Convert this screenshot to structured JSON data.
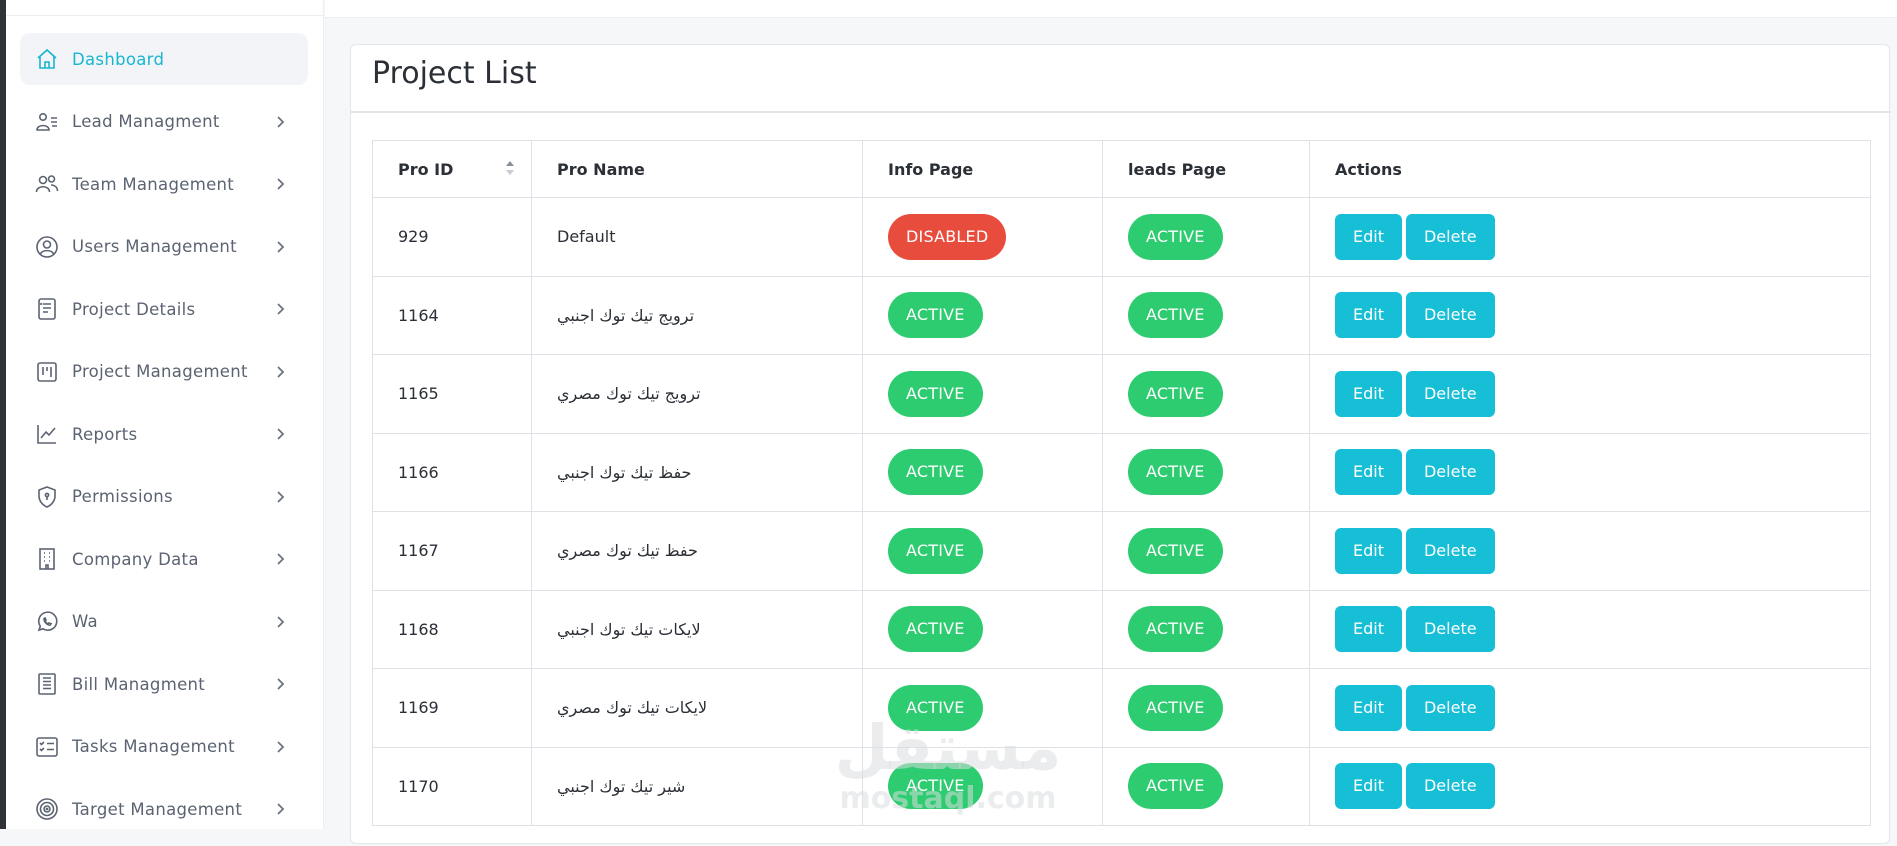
{
  "sidebar": {
    "items": [
      {
        "label": "Dashboard",
        "icon": "home-icon",
        "active": true
      },
      {
        "label": "Lead Managment",
        "icon": "lead-icon"
      },
      {
        "label": "Team Management",
        "icon": "team-icon"
      },
      {
        "label": "Users Management",
        "icon": "user-circle-icon"
      },
      {
        "label": "Project Details",
        "icon": "document-list-icon"
      },
      {
        "label": "Project Management",
        "icon": "kanban-icon"
      },
      {
        "label": "Reports",
        "icon": "chart-line-icon"
      },
      {
        "label": "Permissions",
        "icon": "shield-icon"
      },
      {
        "label": "Company Data",
        "icon": "building-icon"
      },
      {
        "label": "Wa",
        "icon": "whatsapp-icon"
      },
      {
        "label": "Bill Managment",
        "icon": "receipt-icon"
      },
      {
        "label": "Tasks Management",
        "icon": "checklist-icon"
      },
      {
        "label": "Target Management",
        "icon": "target-icon"
      }
    ]
  },
  "main": {
    "title": "Project List",
    "table": {
      "headers": [
        "Pro ID",
        "Pro Name",
        "Info Page",
        "leads Page",
        "Actions"
      ],
      "rows": [
        {
          "id": "929",
          "name": "Default",
          "info": "DISABLED",
          "leads": "ACTIVE"
        },
        {
          "id": "1164",
          "name": "ترويج تيك توك اجنبي",
          "info": "ACTIVE",
          "leads": "ACTIVE"
        },
        {
          "id": "1165",
          "name": "ترويج تيك توك مصري",
          "info": "ACTIVE",
          "leads": "ACTIVE"
        },
        {
          "id": "1166",
          "name": "حفظ تيك توك اجنبي",
          "info": "ACTIVE",
          "leads": "ACTIVE"
        },
        {
          "id": "1167",
          "name": "حفظ تيك توك مصري",
          "info": "ACTIVE",
          "leads": "ACTIVE"
        },
        {
          "id": "1168",
          "name": "لايكات تيك توك اجنبي",
          "info": "ACTIVE",
          "leads": "ACTIVE"
        },
        {
          "id": "1169",
          "name": "لايكات تيك توك مصري",
          "info": "ACTIVE",
          "leads": "ACTIVE"
        },
        {
          "id": "1170",
          "name": "شير تيك توك اجنبي",
          "info": "ACTIVE",
          "leads": "ACTIVE"
        }
      ],
      "edit_label": "Edit",
      "delete_label": "Delete"
    }
  },
  "watermark": {
    "text_ar": "مستقل",
    "text_en": "mostaql.com"
  },
  "colors": {
    "accent": "#16bfd6",
    "active": "#2ecc71",
    "disabled": "#e74c3c"
  }
}
